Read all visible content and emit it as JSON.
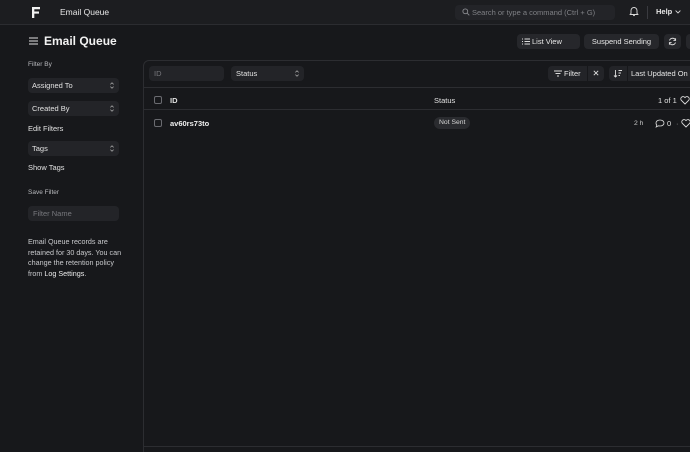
{
  "navbar": {
    "title": "Email Queue",
    "search_placeholder": "Search or type a command (Ctrl + G)",
    "help_label": "Help"
  },
  "page": {
    "title": "Email Queue",
    "list_view_label": "List View",
    "suspend_label": "Suspend Sending"
  },
  "sidebar": {
    "filter_by_label": "Filter By",
    "assigned_to": "Assigned To",
    "created_by": "Created By",
    "edit_filters": "Edit Filters",
    "tags": "Tags",
    "show_tags": "Show Tags",
    "save_filter_label": "Save Filter",
    "filter_name_placeholder": "Filter Name",
    "note_prefix": "Email Queue records are retained for 30 days. You can change the retention policy from ",
    "note_link": "Log Settings",
    "note_suffix": "."
  },
  "filters": {
    "id_placeholder": "ID",
    "status_select": "Status",
    "filter_label": "Filter",
    "sort_label": "Last Updated On"
  },
  "table": {
    "columns": [
      "ID",
      "Status"
    ],
    "count": "1 of 1",
    "rows": [
      {
        "id": "av60rs73to",
        "status": "Not Sent",
        "time": "2 h",
        "comments": "0"
      }
    ]
  },
  "colors": {
    "background": "#17181b",
    "navbar": "#1c1d20",
    "control": "#232428",
    "border": "#2c2d31"
  }
}
